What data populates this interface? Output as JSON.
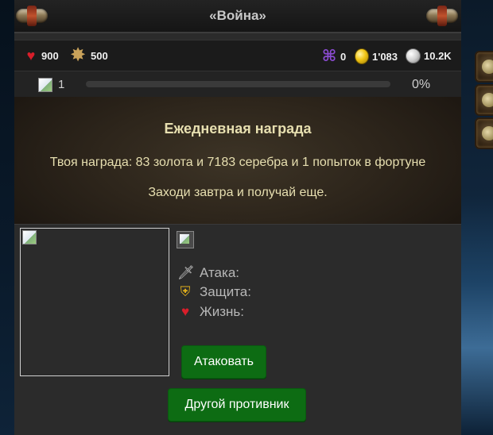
{
  "header": {
    "title": "«Война»",
    "left_emblem": "crossed-axes-emblem",
    "right_emblem": "crossed-axes-emblem"
  },
  "stats": {
    "health": {
      "value": "900",
      "icon": "heart-icon",
      "color": "#d81e2a"
    },
    "energy": {
      "value": "500",
      "icon": "burst-icon",
      "color": "#c9a25a"
    },
    "runes": {
      "value": "0",
      "icon": "rune-icon",
      "color": "#8a4bd0"
    },
    "gold": {
      "value": "1'083",
      "icon": "gold-coin-icon",
      "color": "#f1c515"
    },
    "silver": {
      "value": "10.2K",
      "icon": "silver-coin-icon",
      "color": "#cfcfcf"
    }
  },
  "progress": {
    "level": "1",
    "percent_label": "0%",
    "fraction": 0.0,
    "bar_color": "#8aa53a"
  },
  "daily_reward": {
    "title": "Ежедневная награда",
    "text": "Твоя награда: 83 золота и 7183 серебра и 1 попыток в фортуне",
    "note": "Заходи завтра и получай еще."
  },
  "opponent": {
    "attributes": {
      "attack_label": "Атака:",
      "defense_label": "Защита:",
      "life_label": "Жизнь:"
    }
  },
  "buttons": {
    "attack_label": "Атаковать",
    "other_opponent_label": "Другой противник",
    "color": "#0d6c13"
  },
  "side_tabs": [
    "gear-tab-icon",
    "medal-tab-icon",
    "scroll-tab-icon"
  ]
}
